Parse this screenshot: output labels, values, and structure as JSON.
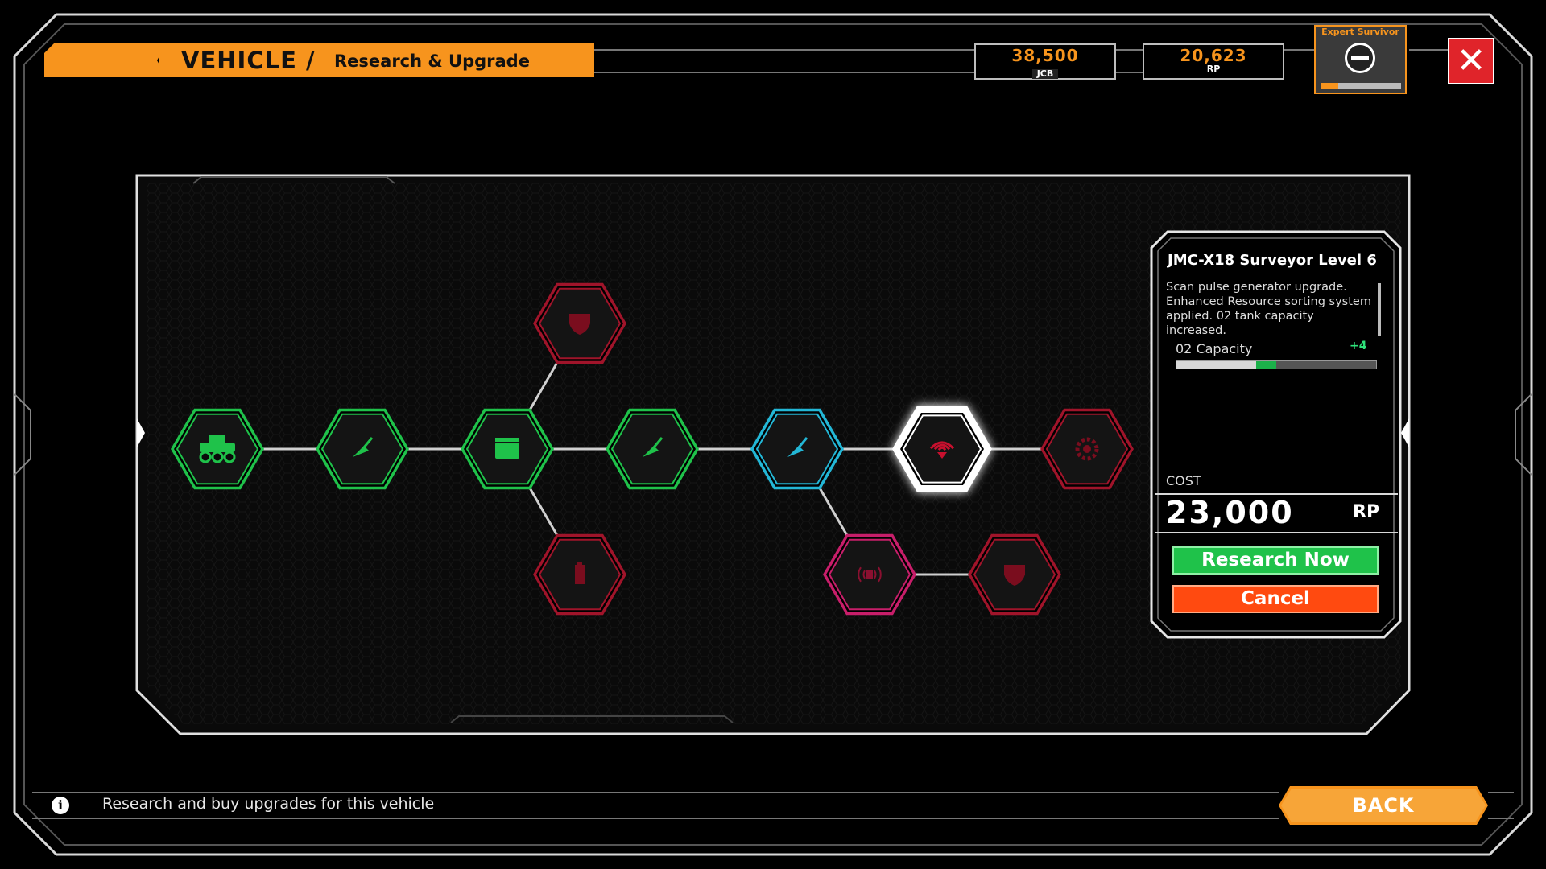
{
  "header": {
    "title": "VEHICLE /",
    "subtitle": "Research & Upgrade",
    "currencies": [
      {
        "value": "38,500",
        "unit": "JCB"
      },
      {
        "value": "20,623",
        "unit": "RP"
      }
    ],
    "rank": {
      "title": "Expert Survivor",
      "progress": 0.22
    },
    "close_label": "✕"
  },
  "tree": {
    "nodes": [
      {
        "id": "base-vehicle",
        "state": "researched",
        "icon": "buggy-icon"
      },
      {
        "id": "scanner-1",
        "state": "researched",
        "icon": "scanner-icon"
      },
      {
        "id": "storage",
        "state": "researched",
        "icon": "storage-box-icon"
      },
      {
        "id": "armor-top",
        "state": "locked",
        "icon": "shield-icon"
      },
      {
        "id": "battery",
        "state": "locked",
        "icon": "battery-icon"
      },
      {
        "id": "scanner-2",
        "state": "researched",
        "icon": "scanner-icon"
      },
      {
        "id": "scanner-3",
        "state": "available",
        "icon": "scanner-icon"
      },
      {
        "id": "surveyor-6",
        "state": "selected",
        "icon": "signal-icon"
      },
      {
        "id": "wheel",
        "state": "locked",
        "icon": "gear-icon"
      },
      {
        "id": "pulse",
        "state": "locked-special",
        "icon": "pulse-icon"
      },
      {
        "id": "armor-bottom",
        "state": "locked",
        "icon": "shield-icon"
      }
    ]
  },
  "card": {
    "title": "JMC-X18 Surveyor Level 6",
    "description": "Scan pulse generator upgrade. Enhanced Resource sorting system applied. 02 tank capacity increased.",
    "stat": {
      "label": "02 Capacity",
      "delta": "+4",
      "base": 0.4,
      "gain": 0.1
    },
    "cost_label": "COST",
    "cost_value": "23,000",
    "cost_unit": "RP",
    "research_label": "Research Now",
    "cancel_label": "Cancel"
  },
  "footer": {
    "info_text": "Research and buy upgrades for this vehicle",
    "back_label": "BACK"
  },
  "colors": {
    "accent": "#f7941d",
    "researched": "#1fc24a",
    "available": "#23b7d6",
    "locked": "#a0142a",
    "locked_special": "#c81e6a",
    "selected": "#ffffff"
  }
}
